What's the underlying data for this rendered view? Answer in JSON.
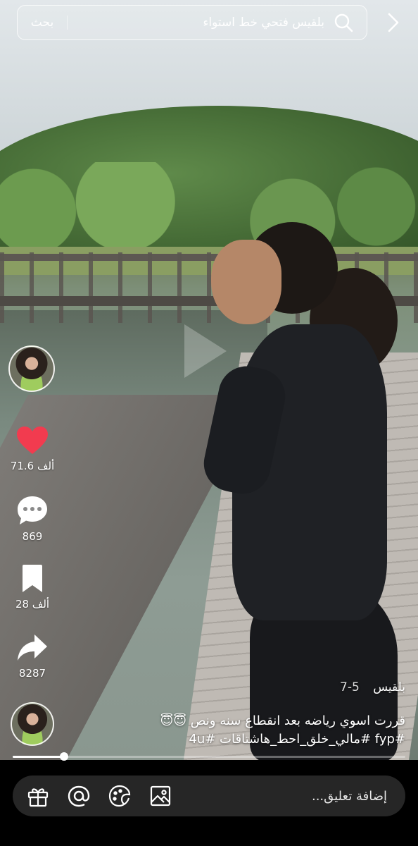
{
  "search": {
    "query": "بلقيس فتحي خط استواء",
    "button_label": "بحث"
  },
  "actions": {
    "likes": "71.6 ألف",
    "comments": "869",
    "saves": "28 ألف",
    "shares": "8287"
  },
  "caption": {
    "username": "بلقيس",
    "part": "5-7",
    "text_line1": "قررت اسوي رياضه بعد انقطاع  سنه ونص 😇😇",
    "text_line2": "#fyp #مالي_خلق_احط_هاشتاقات #4u"
  },
  "progress": {
    "fraction": 0.13
  },
  "comment_bar": {
    "placeholder": "إضافة تعليق..."
  },
  "colors": {
    "like_red": "#f23b4f",
    "bottom_bar": "#000000",
    "comment_field": "#262626"
  },
  "icons": [
    "chevron-right-icon",
    "search-icon",
    "heart-icon",
    "comment-icon",
    "bookmark-icon",
    "share-icon",
    "gift-icon",
    "mention-icon",
    "emoji-icon",
    "image-icon"
  ]
}
